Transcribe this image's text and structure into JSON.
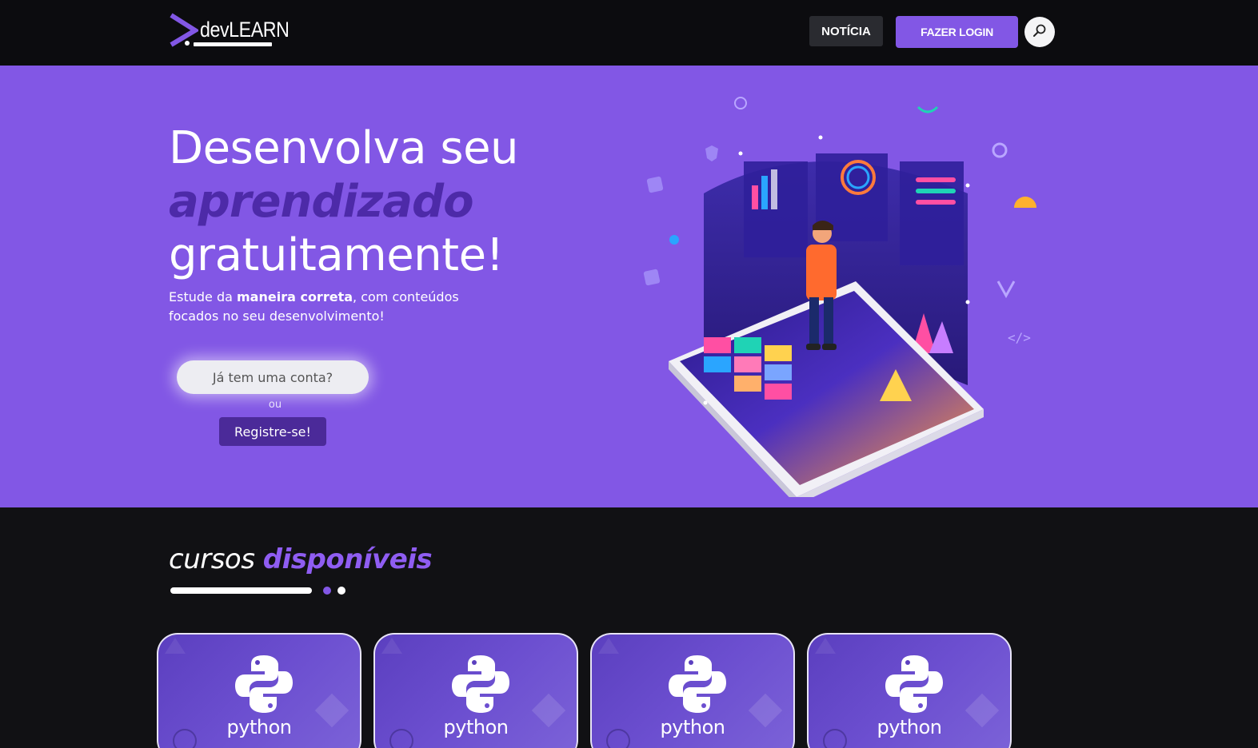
{
  "header": {
    "logo_text": "devLEARN",
    "news_label": "NOTÍCIA",
    "login_label": "FAZER LOGIN",
    "search_icon": "search-icon"
  },
  "hero": {
    "title_line1": "Desenvolva seu",
    "title_emphasis": "aprendizado",
    "title_line3": "gratuitamente!",
    "subtitle_pre": "Estude da ",
    "subtitle_bold": "maneira correta",
    "subtitle_post": ", com conteúdos focados no seu desenvolvimento!",
    "has_account_label": "Já tem uma conta?",
    "or_label": "ou",
    "register_label": "Registre-se!"
  },
  "courses": {
    "title": "cursos",
    "title_accent": "disponíveis",
    "items": [
      {
        "name": "python"
      },
      {
        "name": "python"
      },
      {
        "name": "python"
      },
      {
        "name": "python"
      }
    ]
  },
  "colors": {
    "brand": "#8257e5",
    "brand_dark": "#4b2a99",
    "header_bg": "#0c0c0f",
    "page_bg": "#111114"
  }
}
